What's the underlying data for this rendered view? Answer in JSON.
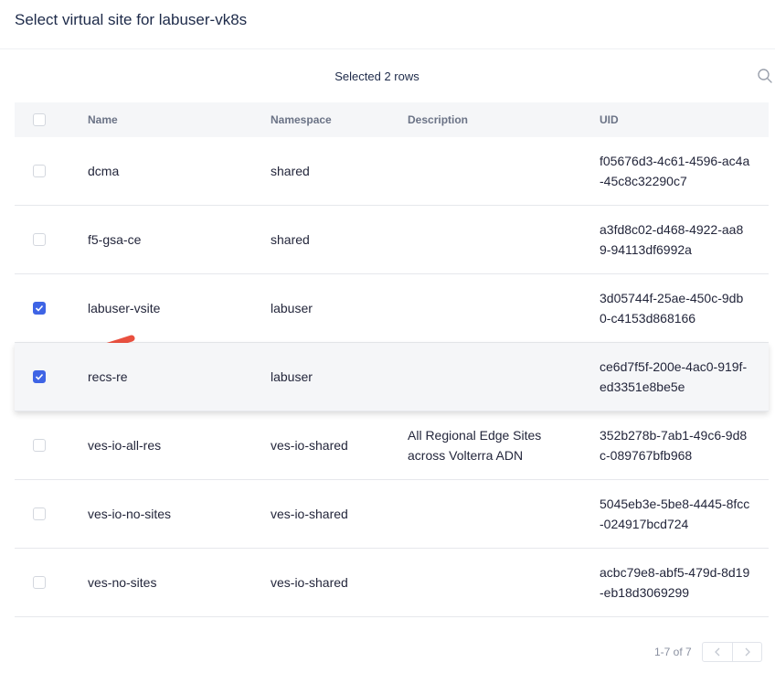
{
  "dialog": {
    "title": "Select virtual site for labuser-vk8s"
  },
  "toolbar": {
    "selected_text": "Selected 2 rows"
  },
  "table": {
    "headers": {
      "name": "Name",
      "namespace": "Namespace",
      "description": "Description",
      "uid": "UID"
    },
    "rows": [
      {
        "name": "dcma",
        "namespace": "shared",
        "description": "",
        "uid": "f05676d3-4c61-4596-ac4a-45c8c32290c7",
        "checked": false
      },
      {
        "name": "f5-gsa-ce",
        "namespace": "shared",
        "description": "",
        "uid": "a3fd8c02-d468-4922-aa89-94113df6992a",
        "checked": false
      },
      {
        "name": "labuser-vsite",
        "namespace": "labuser",
        "description": "",
        "uid": "3d05744f-25ae-450c-9db0-c4153d868166",
        "checked": true
      },
      {
        "name": "recs-re",
        "namespace": "labuser",
        "description": "",
        "uid": "ce6d7f5f-200e-4ac0-919f-ed3351e8be5e",
        "checked": true
      },
      {
        "name": "ves-io-all-res",
        "namespace": "ves-io-shared",
        "description": "All Regional Edge Sites across Volterra ADN",
        "uid": "352b278b-7ab1-49c6-9d8c-089767bfb968",
        "checked": false
      },
      {
        "name": "ves-io-no-sites",
        "namespace": "ves-io-shared",
        "description": "",
        "uid": "5045eb3e-5be8-4445-8fcc-024917bcd724",
        "checked": false
      },
      {
        "name": "ves-no-sites",
        "namespace": "ves-io-shared",
        "description": "",
        "uid": "acbc79e8-abf5-479d-8d19-eb18d3069299",
        "checked": false
      }
    ]
  },
  "pagination": {
    "text": "1-7 of 7"
  },
  "colors": {
    "accent": "#3e64e5",
    "annotation_arrow": "#e9503f"
  },
  "icons": {
    "search": "search-icon",
    "prev": "chevron-left-icon",
    "next": "chevron-right-icon",
    "check": "check-icon",
    "annotation": "arrow-icon",
    "cursor": "cursor-icon"
  }
}
